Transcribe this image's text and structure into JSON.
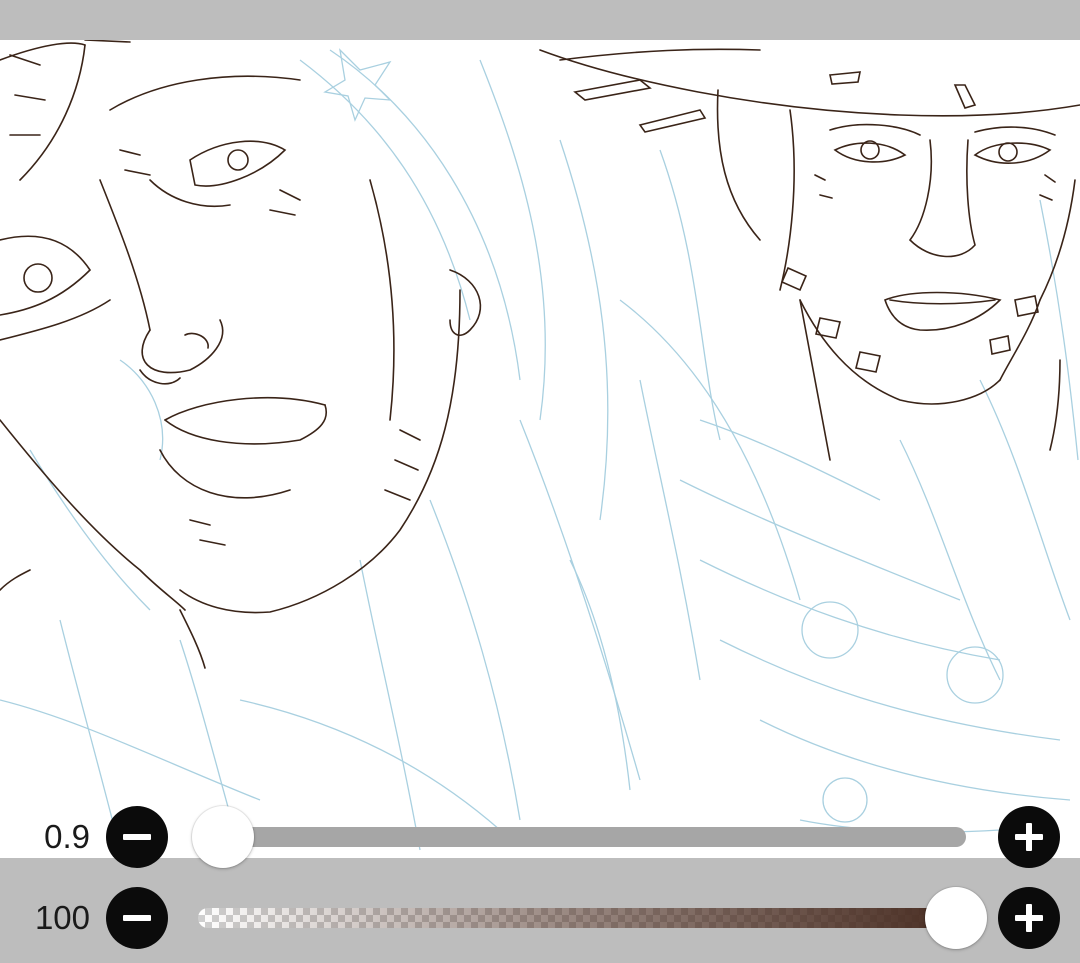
{
  "size_slider": {
    "value_label": "0.9",
    "level_fraction": 0.0,
    "track_color": "#a6a6a6"
  },
  "opacity_slider": {
    "value_label": "100",
    "level_percent": 100,
    "color": "#482c21"
  },
  "buttons": {
    "decrease_icon": "minus-icon",
    "increase_icon": "plus-icon"
  },
  "colors": {
    "chrome": "#bdbdbd",
    "canvas": "#ffffff",
    "ink_lines": "#3a2418",
    "sketch_lines": "#a9d0e0"
  }
}
